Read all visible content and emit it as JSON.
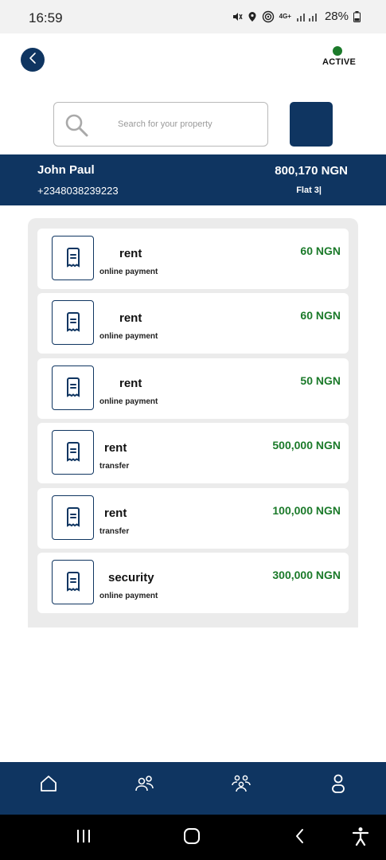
{
  "status_bar": {
    "time": "16:59",
    "network": "4G+",
    "battery": "28%"
  },
  "header": {
    "back_icon": "chevron-left-icon",
    "status_label": "ACTIVE",
    "status_color": "#1b7a2a"
  },
  "search": {
    "placeholder": "Search for your property",
    "value": ""
  },
  "tenant": {
    "name": "John Paul",
    "phone": "+2348038239223",
    "balance": "800,170 NGN",
    "unit": "Flat 3|"
  },
  "transactions": [
    {
      "title": "rent",
      "method": "online payment",
      "amount": "60 NGN"
    },
    {
      "title": "rent",
      "method": "online payment",
      "amount": "60 NGN"
    },
    {
      "title": "rent",
      "method": "online payment",
      "amount": "50 NGN"
    },
    {
      "title": "rent",
      "method": "transfer",
      "amount": "500,000 NGN"
    },
    {
      "title": "rent",
      "method": "transfer",
      "amount": "100,000 NGN"
    },
    {
      "title": "security",
      "method": "online payment",
      "amount": "300,000 NGN"
    }
  ],
  "bottom_nav": [
    "home-icon",
    "users-icon",
    "group-icon",
    "profile-icon"
  ],
  "colors": {
    "primary": "#0f3561",
    "amount": "#1b7a2a",
    "panel": "#ebebeb"
  }
}
